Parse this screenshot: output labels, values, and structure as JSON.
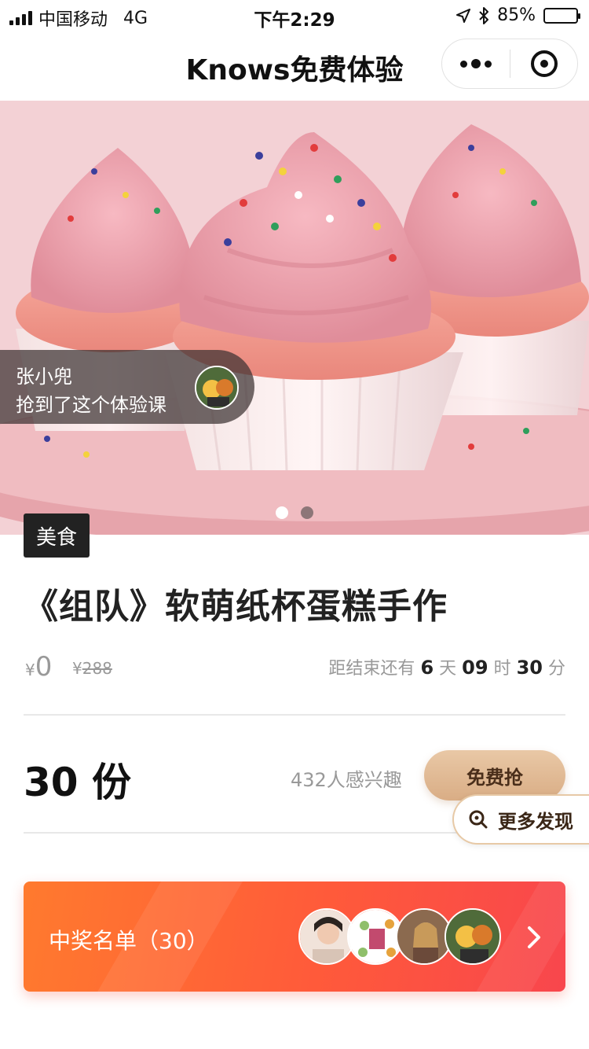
{
  "status_bar": {
    "carrier": "中国移动",
    "network": "4G",
    "time": "下午2:29",
    "battery_percent": "85%",
    "battery_level": 0.85
  },
  "nav": {
    "title": "Knows免费体验"
  },
  "banner": {
    "winner_name": "张小兜",
    "winner_text": "抢到了这个体验课",
    "slide_count": 2,
    "active_slide": 1
  },
  "course": {
    "category": "美食",
    "title": "《组队》软萌纸杯蛋糕手作",
    "currency": "¥",
    "price": "0",
    "original_price": "288"
  },
  "countdown": {
    "prefix": "距结束还有",
    "days": "6",
    "days_unit": "天",
    "hours": "09",
    "hours_unit": "时",
    "minutes": "30",
    "minutes_unit": "分"
  },
  "stock": {
    "label": "30 份",
    "interested": "432人感兴趣",
    "grab_button": "免费抢"
  },
  "discover": {
    "label": "更多发现"
  },
  "winners": {
    "label": "中奖名单（30）"
  },
  "colors": {
    "accent_gold": "#d9ad85",
    "winners_gradient_start": "#ff7a2e",
    "winners_gradient_end": "#f8464d"
  }
}
